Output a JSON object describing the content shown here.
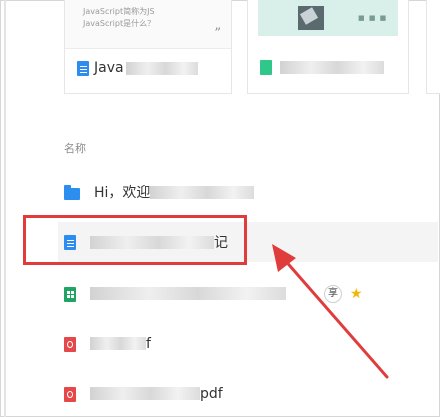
{
  "top_cards": [
    {
      "preview_lines": [
        "JavaScript简称为JS",
        "JavaScript是什么？"
      ],
      "quote_mark": "”",
      "name_prefix": "Java"
    },
    {
      "preview_dots": "■ ■ ■"
    }
  ],
  "section_label": "名称",
  "rows": [
    {
      "icon": "folder-icon",
      "label_prefix": "Hi，欢迎"
    },
    {
      "icon": "doc-icon",
      "label_suffix": "记",
      "highlighted": true
    },
    {
      "icon": "sheet-icon",
      "share_label": "享",
      "starred": true
    },
    {
      "icon": "pdf-icon",
      "label_suffix": "f"
    },
    {
      "icon": "pdf-icon",
      "label_suffix": "pdf"
    }
  ],
  "annotation": {
    "box_color": "#e03c3c",
    "arrow_color": "#e03c3c"
  },
  "colors": {
    "doc_blue": "#2d8cf0",
    "folder_blue": "#2c8ff0",
    "sheet_green": "#1fa463",
    "pdf_red": "#e54848",
    "star": "#f2b705"
  }
}
